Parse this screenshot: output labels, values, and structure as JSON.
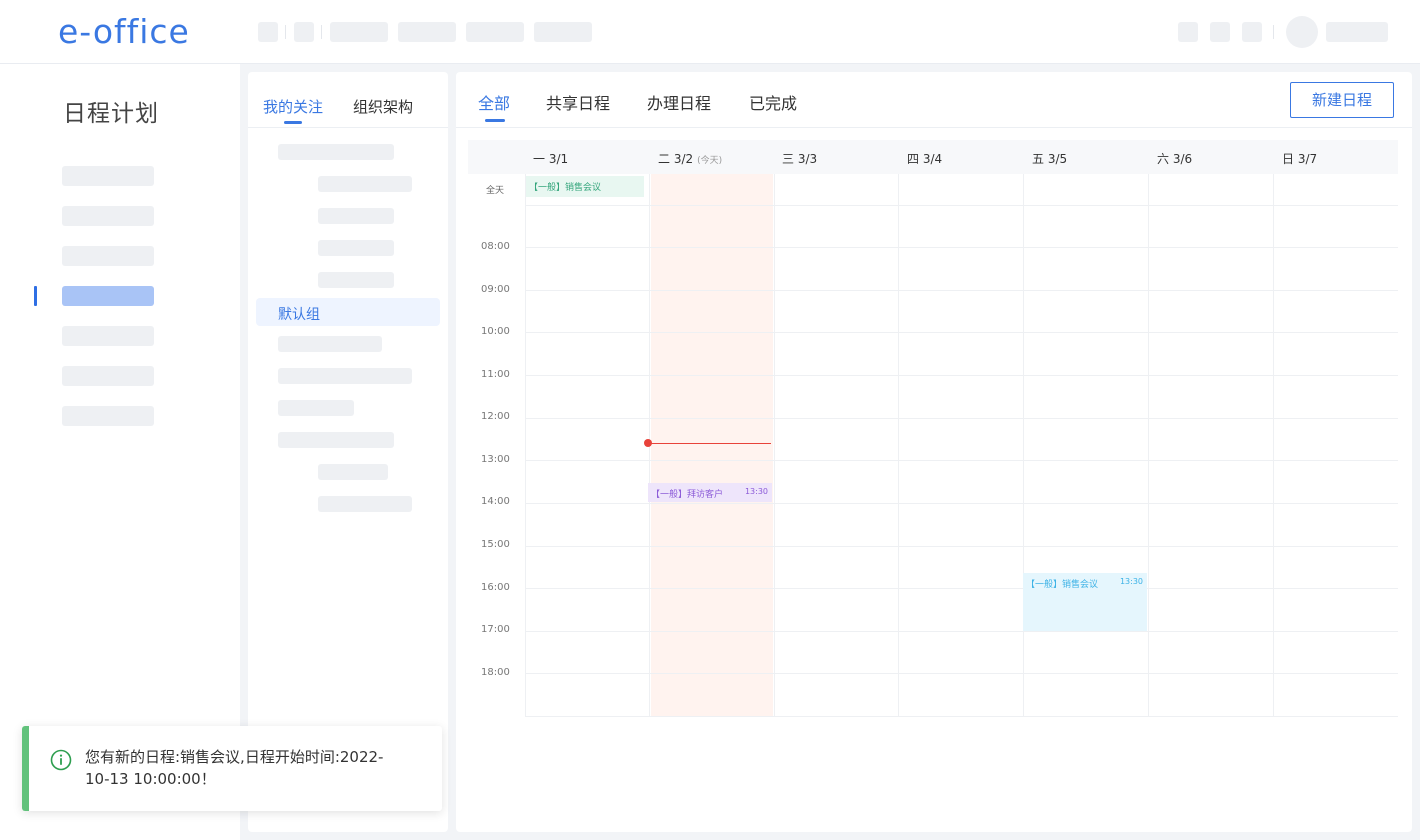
{
  "app": {
    "logo": "e-office"
  },
  "sidebar": {
    "title": "日程计划"
  },
  "follow_panel": {
    "tabs": [
      {
        "label": "我的关注",
        "active": true
      },
      {
        "label": "组织架构",
        "active": false
      }
    ],
    "default_group": "默认组"
  },
  "calendar": {
    "tabs": [
      {
        "label": "全部",
        "active": true
      },
      {
        "label": "共享日程",
        "active": false
      },
      {
        "label": "办理日程",
        "active": false
      },
      {
        "label": "已完成",
        "active": false
      }
    ],
    "new_button": "新建日程",
    "days": [
      {
        "label": "一 3/1"
      },
      {
        "label": "二 3/2",
        "tag": "(今天)",
        "today": true
      },
      {
        "label": "三 3/3"
      },
      {
        "label": "四 3/4"
      },
      {
        "label": "五 3/5"
      },
      {
        "label": "六 3/6"
      },
      {
        "label": "日 3/7"
      }
    ],
    "allday_label": "全天",
    "times": [
      "08:00",
      "09:00",
      "10:00",
      "11:00",
      "12:00",
      "13:00",
      "14:00",
      "15:00",
      "16:00",
      "17:00",
      "18:00"
    ],
    "events": [
      {
        "title": "【一般】销售会议",
        "time": "",
        "day": "一 3/1",
        "allday": true,
        "color": "#33a57b"
      },
      {
        "title": "【一般】拜访客户",
        "time": "13:30",
        "day": "二 3/2",
        "color": "#8c5bd8"
      },
      {
        "title": "【一般】销售会议",
        "time": "13:30",
        "day": "五 3/5",
        "color": "#3cb2e6"
      }
    ]
  },
  "notification": {
    "icon": "info-icon",
    "message": "您有新的日程:销售会议,日程开始时间:2022-10-13 10:00:00！",
    "color": "#62c27c"
  },
  "colors": {
    "accent": "#3a78e2",
    "now_line": "#e8423a",
    "today_bg": "#fff3ef"
  }
}
